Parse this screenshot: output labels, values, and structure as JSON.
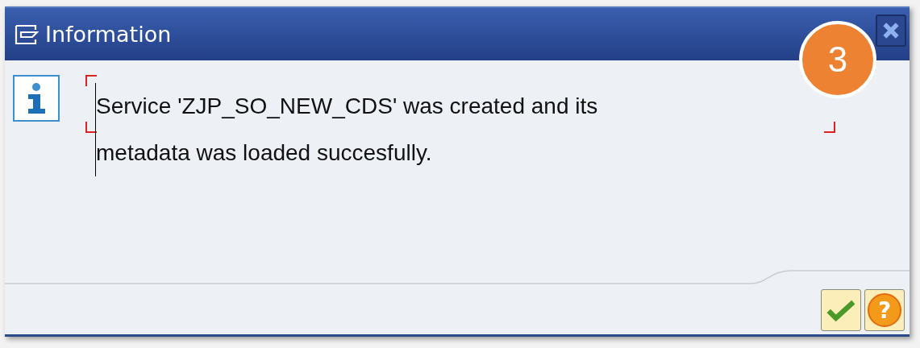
{
  "window": {
    "title": "Information"
  },
  "message": {
    "text": "Service 'ZJP_SO_NEW_CDS' was created and its metadata was loaded succesfully.",
    "focused": true
  },
  "step_badge": "3",
  "buttons": [
    {
      "kind": "confirm"
    },
    {
      "kind": "help",
      "label": "?"
    }
  ]
}
